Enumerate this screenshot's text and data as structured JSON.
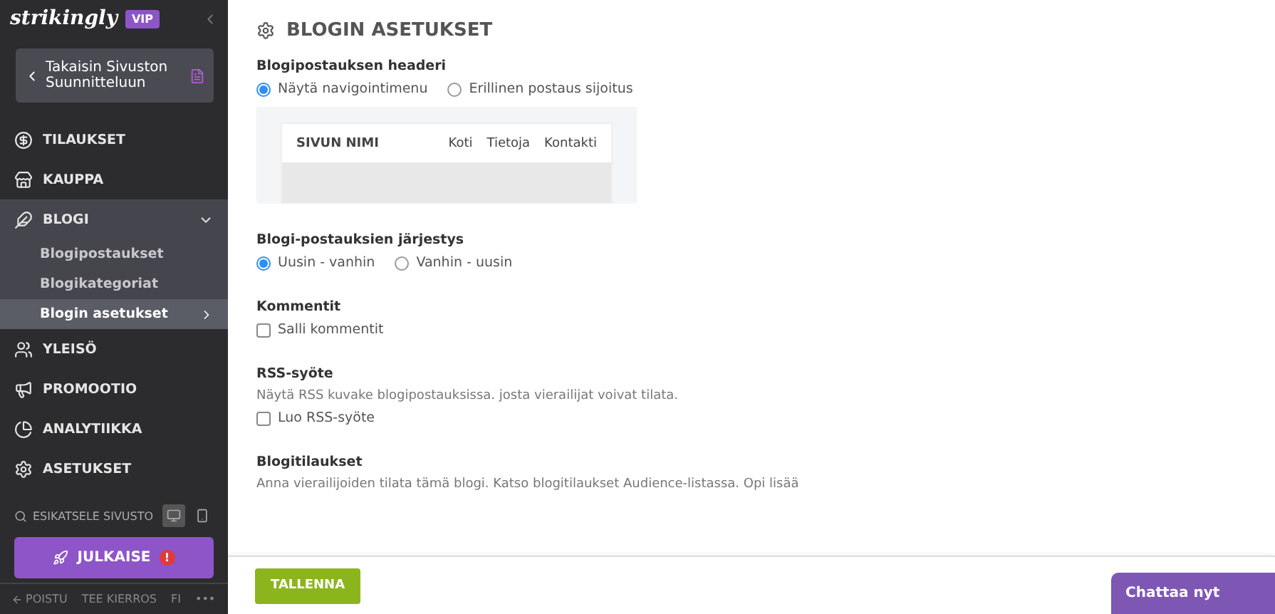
{
  "sidebar": {
    "logo": "strikingly",
    "badge": "VIP",
    "back_button": "Takaisin Sivuston Suunnitteluun",
    "items": [
      {
        "label": "TILAUKSET",
        "selected": false
      },
      {
        "label": "KAUPPA",
        "selected": false
      },
      {
        "label": "BLOGI",
        "selected": true,
        "expanded": true,
        "children": [
          {
            "label": "Blogipostaukset",
            "selected": false
          },
          {
            "label": "Blogikategoriat",
            "selected": false
          },
          {
            "label": "Blogin asetukset",
            "selected": true
          }
        ]
      },
      {
        "label": "YLEISÖ",
        "selected": false
      },
      {
        "label": "PROMOOTIO",
        "selected": false
      },
      {
        "label": "ANALYTIIKKA",
        "selected": false
      },
      {
        "label": "ASETUKSET",
        "selected": false
      }
    ],
    "preview": "ESIKATSELE SIVUSTO",
    "preview_devices": [
      {
        "kind": "desktop",
        "selected": true
      },
      {
        "kind": "mobile",
        "selected": false
      }
    ],
    "publish": "JULKAISE",
    "publish_alert": "!",
    "footer": [
      "POISTU",
      "TEE KIERROS",
      "FI",
      "•••"
    ]
  },
  "page": {
    "title": "BLOGIN ASETUKSET",
    "sections": [
      {
        "kind": "radio",
        "heading": "Blogipostauksen headeri",
        "options": [
          {
            "label": "Näytä navigointimenu",
            "selected": true
          },
          {
            "label": "Erillinen postaus sijoitus",
            "selected": false
          }
        ],
        "preview": {
          "site_name": "SIVUN NIMI",
          "links": [
            "Koti",
            "Tietoja",
            "Kontakti"
          ]
        }
      },
      {
        "kind": "radio",
        "heading": "Blogi-postauksien järjestys",
        "options": [
          {
            "label": "Uusin - vanhin",
            "selected": true
          },
          {
            "label": "Vanhin - uusin",
            "selected": false
          }
        ]
      },
      {
        "kind": "checkbox",
        "heading": "Kommentit",
        "options": [
          {
            "label": "Salli kommentit",
            "checked": false
          }
        ]
      },
      {
        "kind": "checkbox",
        "heading": "RSS-syöte",
        "description": "Näytä RSS kuvake blogipostauksissa. josta vierailijat voivat tilata.",
        "options": [
          {
            "label": "Luo RSS-syöte",
            "checked": false
          }
        ]
      },
      {
        "kind": "text",
        "heading": "Blogitilaukset",
        "description": "Anna vierailijoiden tilata tämä blogi. Katso blogitilaukset Audience-listassa. Opi lisää"
      }
    ]
  },
  "save_button": "TALLENNA",
  "chat_button": "Chattaa nyt"
}
